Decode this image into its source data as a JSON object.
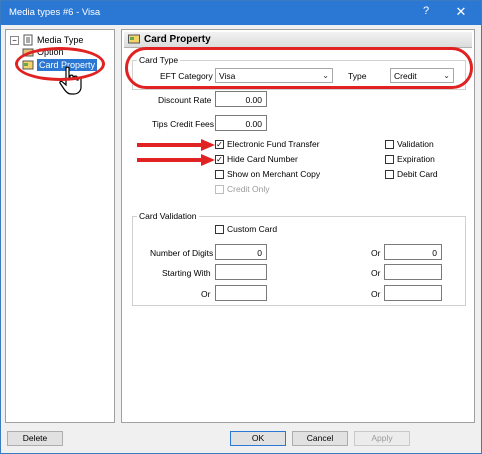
{
  "window": {
    "title": "Media types #6 - Visa",
    "help": "?",
    "close": "✕"
  },
  "tree": {
    "items": [
      {
        "label": "Media Type"
      },
      {
        "label": "Option"
      },
      {
        "label": "Card Property"
      }
    ]
  },
  "panel": {
    "title": "Card Property",
    "card_type": {
      "group_label": "Card Type",
      "eft_category_label": "EFT Category",
      "eft_category_value": "Visa",
      "type_label": "Type",
      "type_value": "Credit"
    },
    "discount_rate_label": "Discount Rate",
    "discount_rate_value": "0.00",
    "tips_credit_fees_label": "Tips Credit Fees",
    "tips_credit_fees_value": "0.00",
    "checkboxes": {
      "electronic_fund_transfer": {
        "label": "Electronic Fund Transfer",
        "checked": true
      },
      "hide_card_number": {
        "label": "Hide Card Number",
        "checked": true
      },
      "show_on_merchant_copy": {
        "label": "Show on Merchant Copy",
        "checked": false
      },
      "credit_only": {
        "label": "Credit Only",
        "checked": false
      },
      "validation": {
        "label": "Validation",
        "checked": false
      },
      "expiration": {
        "label": "Expiration",
        "checked": false
      },
      "debit_card": {
        "label": "Debit Card",
        "checked": false
      }
    },
    "card_validation": {
      "group_label": "Card Validation",
      "custom_card_label": "Custom Card",
      "number_of_digits_label": "Number of Digits",
      "number_of_digits_value": "0",
      "starting_with_label": "Starting With",
      "starting_with_value": "",
      "or_label": "Or",
      "or_digits_value": "0",
      "or_starting_value": "",
      "or_left_value": "",
      "or_right_value": ""
    }
  },
  "buttons": {
    "delete": "Delete",
    "ok": "OK",
    "cancel": "Cancel",
    "apply": "Apply"
  },
  "colors": {
    "title_bar": "#2b78d4",
    "callout": "#e02222",
    "selection": "#2b78d4"
  }
}
